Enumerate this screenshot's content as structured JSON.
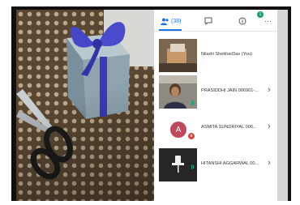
{
  "tabs": [
    {
      "name": "participants",
      "icon": "people-icon",
      "label": "(38)"
    },
    {
      "name": "chat",
      "icon": "chat-icon",
      "badge": "1"
    },
    {
      "name": "info",
      "icon": "info-icon"
    },
    {
      "name": "more",
      "icon": "more-icon",
      "label": "⋯"
    }
  ],
  "participants": [
    {
      "name": "Niladri ShekharDas (You)",
      "tile": "video",
      "has_menu": false
    },
    {
      "name": "PRASIDDHI JAIN 006901-...",
      "tile": "video",
      "has_menu": true
    },
    {
      "name": "ASMITA SUNDRIYAL 006...",
      "tile": "avatar",
      "initial": "A",
      "has_menu": true
    },
    {
      "name": "HITANSHI AGGARWAL 00...",
      "tile": "video-muted",
      "has_menu": true
    }
  ],
  "chevron": "›",
  "colors": {
    "accent": "#1a73e8",
    "avatar_bg": "#c0485a",
    "mic_active": "#1a9e73",
    "muted_badge": "#d94a3d"
  }
}
